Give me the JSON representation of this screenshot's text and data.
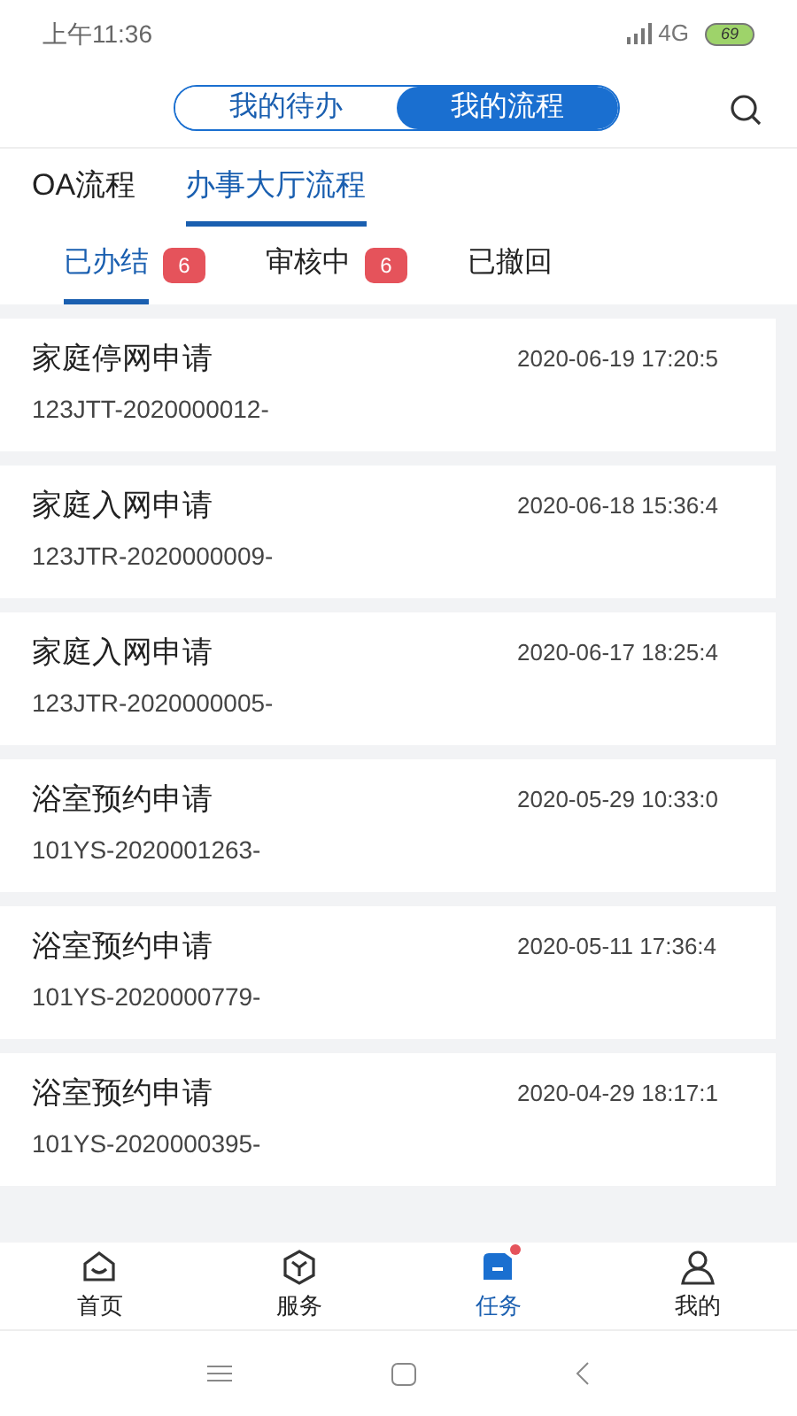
{
  "status_bar": {
    "time": "上午11:36",
    "network": "4G",
    "battery": "69"
  },
  "segments": [
    {
      "label": "我的待办",
      "selected": false
    },
    {
      "label": "我的流程",
      "selected": true
    }
  ],
  "tabs": [
    {
      "label": "OA流程",
      "selected": false
    },
    {
      "label": "办事大厅流程",
      "selected": true
    }
  ],
  "sub_tabs": [
    {
      "label": "已办结",
      "badge": "6",
      "selected": true
    },
    {
      "label": "审核中",
      "badge": "6",
      "selected": false
    },
    {
      "label": "已撤回",
      "selected": false
    }
  ],
  "items": [
    {
      "title": "家庭停网申请",
      "number": "123JTT-2020000012-",
      "time": "2020-06-19 17:20:5"
    },
    {
      "title": "家庭入网申请",
      "number": "123JTR-2020000009-",
      "time": "2020-06-18 15:36:4"
    },
    {
      "title": "家庭入网申请",
      "number": "123JTR-2020000005-",
      "time": "2020-06-17 18:25:4"
    },
    {
      "title": "浴室预约申请",
      "number": "101YS-2020001263-",
      "time": "2020-05-29 10:33:0"
    },
    {
      "title": "浴室预约申请",
      "number": "101YS-2020000779-",
      "time": "2020-05-11 17:36:4"
    },
    {
      "title": "浴室预约申请",
      "number": "101YS-2020000395-",
      "time": "2020-04-29 18:17:1"
    }
  ],
  "bottom_nav": [
    {
      "label": "首页",
      "kind": "home",
      "selected": false
    },
    {
      "label": "服务",
      "kind": "service",
      "selected": false
    },
    {
      "label": "任务",
      "kind": "task",
      "selected": true,
      "dot": true
    },
    {
      "label": "我的",
      "kind": "me",
      "selected": false
    }
  ]
}
